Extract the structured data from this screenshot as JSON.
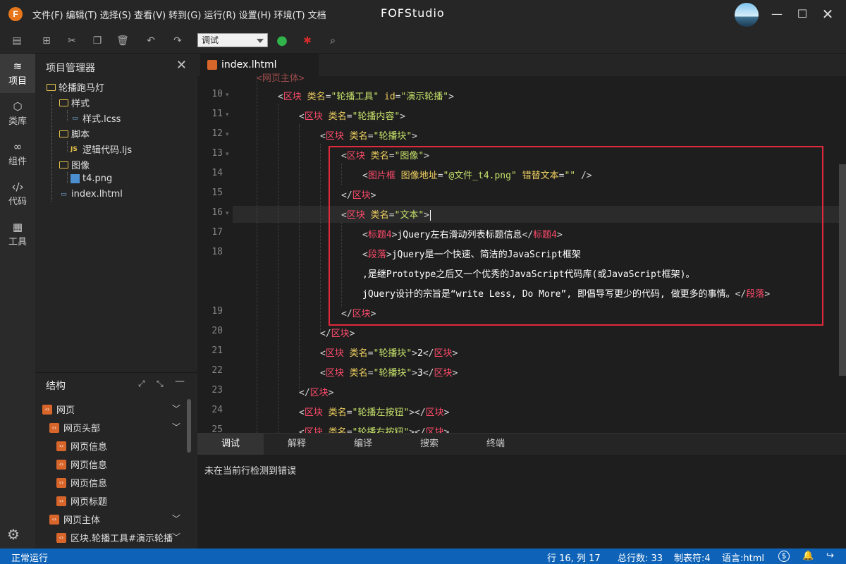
{
  "app": {
    "title": "FOFStudio",
    "logo": "F"
  },
  "menu": [
    "文件(F)",
    "编辑(T)",
    "选择(S)",
    "查看(V)",
    "转到(G)",
    "运行(R)",
    "设置(H)",
    "环境(T)",
    "文档"
  ],
  "toolbar": {
    "mode_value": "调试"
  },
  "activity": [
    {
      "label": "项目",
      "icon": "layers-icon"
    },
    {
      "label": "类库",
      "icon": "cube-icon"
    },
    {
      "label": "组件",
      "icon": "link-icon"
    },
    {
      "label": "代码",
      "icon": "code-icon"
    },
    {
      "label": "工具",
      "icon": "tools-icon"
    }
  ],
  "project": {
    "header": "项目管理器",
    "root": "轮播跑马灯",
    "items": [
      "样式",
      "样式.lcss",
      "脚本",
      "逻辑代码.ljs",
      "图像",
      "t4.png",
      "index.lhtml"
    ]
  },
  "structure": {
    "header": "结构",
    "nodes": [
      "网页",
      "网页头部",
      "网页信息",
      "网页信息",
      "网页信息",
      "网页标题",
      "网页主体",
      "区块.轮播工具#演示轮播"
    ]
  },
  "editor": {
    "tab": "index.lhtml",
    "line_numbers": [
      "10",
      "11",
      "12",
      "13",
      "14",
      "15",
      "16",
      "17",
      "18",
      "19",
      "20",
      "21",
      "22",
      "23",
      "24",
      "25"
    ],
    "code_text": {
      "l18b": ",是继Prototype之后又一个优秀的JavaScript代码库(或JavaScript框架)。",
      "l18c": "jQuery设计的宗旨是“write Less, Do More”, 即倡导写更少的代码, 做更多的事情。"
    }
  },
  "bottom": {
    "tabs": [
      "调试",
      "解释",
      "编译",
      "搜索",
      "终端"
    ],
    "message": "未在当前行检测到错误"
  },
  "status": {
    "left": "正常运行",
    "position": "行 16, 列 17",
    "total": "总行数: 33",
    "tab": "制表符:4",
    "lang": "语言:html"
  },
  "colors": {
    "accent": "#0e63b8",
    "highlight_box": "#e0293a",
    "tag": "#ff4b6b",
    "attr": "#f0d060",
    "string": "#c5e06a"
  }
}
